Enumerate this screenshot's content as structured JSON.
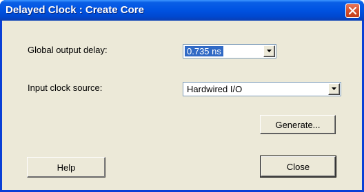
{
  "window": {
    "title": "Delayed Clock : Create Core"
  },
  "fields": {
    "delay_label": "Global output delay:",
    "delay_value": "0.735 ns",
    "clock_label": "Input clock source:",
    "clock_value": "Hardwired I/O"
  },
  "buttons": {
    "generate": "Generate...",
    "help": "Help",
    "close": "Close"
  },
  "colors": {
    "titlebar": "#0054e3",
    "client_background": "#ece9d8",
    "selection": "#316ac5",
    "close_button": "#d8532f"
  }
}
